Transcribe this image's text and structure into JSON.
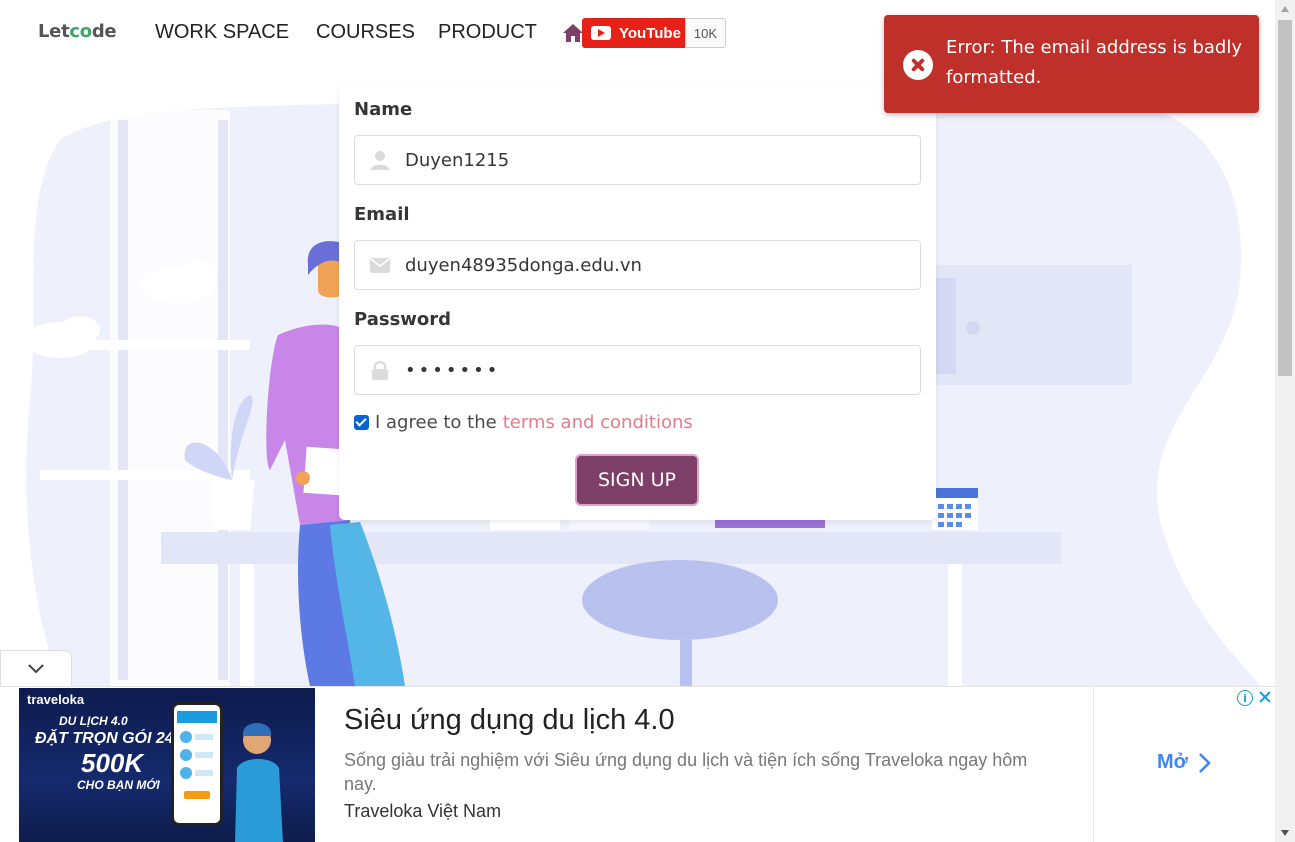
{
  "navbar": {
    "logo_prefix": "Let",
    "logo_oo": "co",
    "logo_suffix": "de",
    "items": [
      "WORK SPACE",
      "COURSES",
      "PRODUCT"
    ],
    "youtube_label": "YouTube",
    "youtube_count": "10K"
  },
  "form": {
    "name_label": "Name",
    "name_value": "Duyen1215",
    "email_label": "Email",
    "email_value": "duyen48935donga.edu.vn",
    "password_label": "Password",
    "password_value": "•••••••",
    "agree_prefix": "I agree to the",
    "agree_link": "terms and conditions",
    "agree_checked": true,
    "submit_label": "SIGN UP"
  },
  "toast": {
    "message": "Error: The email address is badly formatted.",
    "color": "#c0302b"
  },
  "ad": {
    "image_brand": "traveloka",
    "image_line1": "DU LỊCH 4.0",
    "image_line2": "ĐẶT TRỌN GÓI 24/7",
    "image_line3": "500K",
    "image_line4": "CHO BẠN MỚI",
    "title": "Siêu ứng dụng du lịch 4.0",
    "description": "Sống giàu trải nghiệm với Siêu ứng dụng du lịch và tiện ích sống Traveloka ngay hôm nay.",
    "advertiser": "Traveloka Việt Nam",
    "cta": "Mở"
  },
  "colors": {
    "accent": "#7d3f67",
    "link": "#e57a8a",
    "youtube": "#e62117",
    "illustration": "#eef0fb"
  }
}
